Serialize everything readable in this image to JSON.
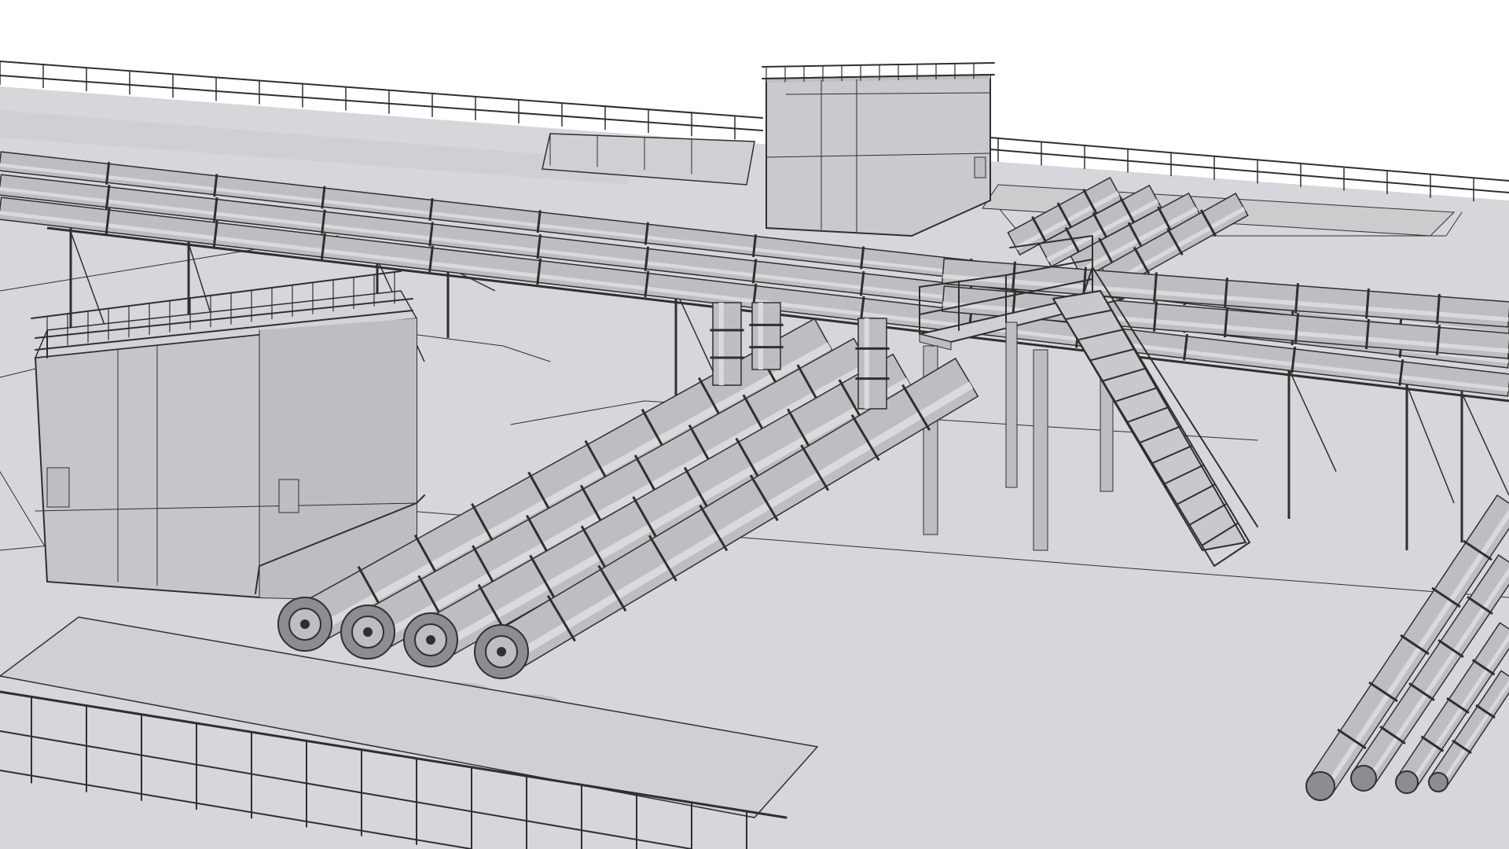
{
  "scene": {
    "kind": "3D wireframe render of rooftop industrial piping",
    "palette": {
      "sky": "#ffffff",
      "roof": "#d6d7da",
      "roof_shade": "#c9cacd",
      "pipe": "#bdbec1",
      "pipe_dark": "#8c8d90",
      "line": "#2f2f2f",
      "shadow": "#b3b4b8"
    },
    "objects": [
      "rooftop-deck",
      "back-parapet-railing",
      "overhead-pipe-rack",
      "left-utility-building",
      "rear-utility-building",
      "four-valved-pipes",
      "elevated-platform",
      "access-stair",
      "right-pipe-bundle",
      "front-walkway-railing",
      "front-slab"
    ]
  }
}
